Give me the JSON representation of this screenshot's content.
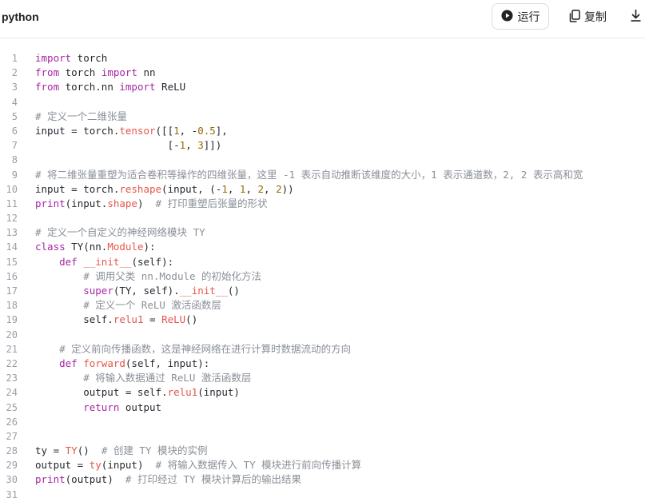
{
  "header": {
    "language": "python",
    "run_label": "运行",
    "copy_label": "复制",
    "run_icon": "play-circle-icon",
    "copy_icon": "copy-icon",
    "download_icon": "download-icon"
  },
  "code": {
    "lines": [
      {
        "n": "1",
        "t": [
          [
            "kw",
            "import"
          ],
          [
            "p",
            " torch"
          ]
        ]
      },
      {
        "n": "2",
        "t": [
          [
            "kw",
            "from"
          ],
          [
            "p",
            " torch "
          ],
          [
            "kw",
            "import"
          ],
          [
            "p",
            " nn"
          ]
        ]
      },
      {
        "n": "3",
        "t": [
          [
            "kw",
            "from"
          ],
          [
            "p",
            " torch.nn "
          ],
          [
            "kw",
            "import"
          ],
          [
            "p",
            " ReLU"
          ]
        ]
      },
      {
        "n": "4",
        "t": []
      },
      {
        "n": "5",
        "t": [
          [
            "cm",
            "# 定义一个二维张量"
          ]
        ]
      },
      {
        "n": "6",
        "t": [
          [
            "p",
            "input = torch."
          ],
          [
            "fn",
            "tensor"
          ],
          [
            "p",
            "([["
          ],
          [
            "num",
            "1"
          ],
          [
            "p",
            ", -"
          ],
          [
            "num",
            "0.5"
          ],
          [
            "p",
            "],"
          ]
        ]
      },
      {
        "n": "7",
        "t": [
          [
            "p",
            "                      ["
          ],
          [
            "p",
            "-"
          ],
          [
            "num",
            "1"
          ],
          [
            "p",
            ", "
          ],
          [
            "num",
            "3"
          ],
          [
            "p",
            "]])"
          ]
        ]
      },
      {
        "n": "8",
        "t": []
      },
      {
        "n": "9",
        "t": [
          [
            "cm",
            "# 将二维张量重塑为适合卷积等操作的四维张量，这里 -1 表示自动推断该维度的大小，1 表示通道数，2, 2 表示高和宽"
          ]
        ]
      },
      {
        "n": "10",
        "t": [
          [
            "p",
            "input = torch."
          ],
          [
            "fn",
            "reshape"
          ],
          [
            "p",
            "(input, (-"
          ],
          [
            "num",
            "1"
          ],
          [
            "p",
            ", "
          ],
          [
            "num",
            "1"
          ],
          [
            "p",
            ", "
          ],
          [
            "num",
            "2"
          ],
          [
            "p",
            ", "
          ],
          [
            "num",
            "2"
          ],
          [
            "p",
            "))"
          ]
        ]
      },
      {
        "n": "11",
        "t": [
          [
            "kw",
            "print"
          ],
          [
            "p",
            "(input."
          ],
          [
            "fn",
            "shape"
          ],
          [
            "p",
            ")  "
          ],
          [
            "cm",
            "# 打印重塑后张量的形状"
          ]
        ]
      },
      {
        "n": "12",
        "t": []
      },
      {
        "n": "13",
        "t": [
          [
            "cm",
            "# 定义一个自定义的神经网络模块 TY"
          ]
        ]
      },
      {
        "n": "14",
        "t": [
          [
            "kw",
            "class"
          ],
          [
            "p",
            " TY(nn."
          ],
          [
            "fn",
            "Module"
          ],
          [
            "p",
            "):"
          ]
        ]
      },
      {
        "n": "15",
        "t": [
          [
            "p",
            "    "
          ],
          [
            "kw",
            "def"
          ],
          [
            "p",
            " "
          ],
          [
            "fn",
            "__init__"
          ],
          [
            "p",
            "(self):"
          ]
        ]
      },
      {
        "n": "16",
        "t": [
          [
            "p",
            "        "
          ],
          [
            "cm",
            "# 调用父类 nn.Module 的初始化方法"
          ]
        ]
      },
      {
        "n": "17",
        "t": [
          [
            "p",
            "        "
          ],
          [
            "kw",
            "super"
          ],
          [
            "p",
            "(TY, self)."
          ],
          [
            "fn",
            "__init__"
          ],
          [
            "p",
            "()"
          ]
        ]
      },
      {
        "n": "18",
        "t": [
          [
            "p",
            "        "
          ],
          [
            "cm",
            "# 定义一个 ReLU 激活函数层"
          ]
        ]
      },
      {
        "n": "19",
        "t": [
          [
            "p",
            "        self."
          ],
          [
            "fn",
            "relu1"
          ],
          [
            "p",
            " = "
          ],
          [
            "fn",
            "ReLU"
          ],
          [
            "p",
            "()"
          ]
        ]
      },
      {
        "n": "20",
        "t": []
      },
      {
        "n": "21",
        "t": [
          [
            "p",
            "    "
          ],
          [
            "cm",
            "# 定义前向传播函数，这是神经网络在进行计算时数据流动的方向"
          ]
        ]
      },
      {
        "n": "22",
        "t": [
          [
            "p",
            "    "
          ],
          [
            "kw",
            "def"
          ],
          [
            "p",
            " "
          ],
          [
            "fn",
            "forward"
          ],
          [
            "p",
            "(self, input):"
          ]
        ]
      },
      {
        "n": "23",
        "t": [
          [
            "p",
            "        "
          ],
          [
            "cm",
            "# 将输入数据通过 ReLU 激活函数层"
          ]
        ]
      },
      {
        "n": "24",
        "t": [
          [
            "p",
            "        output = self."
          ],
          [
            "fn",
            "relu1"
          ],
          [
            "p",
            "(input)"
          ]
        ]
      },
      {
        "n": "25",
        "t": [
          [
            "p",
            "        "
          ],
          [
            "kw",
            "return"
          ],
          [
            "p",
            " output"
          ]
        ]
      },
      {
        "n": "26",
        "t": []
      },
      {
        "n": "27",
        "t": []
      },
      {
        "n": "28",
        "t": [
          [
            "p",
            "ty = "
          ],
          [
            "fn",
            "TY"
          ],
          [
            "p",
            "()  "
          ],
          [
            "cm",
            "# 创建 TY 模块的实例"
          ]
        ]
      },
      {
        "n": "29",
        "t": [
          [
            "p",
            "output = "
          ],
          [
            "fn",
            "ty"
          ],
          [
            "p",
            "(input)  "
          ],
          [
            "cm",
            "# 将输入数据传入 TY 模块进行前向传播计算"
          ]
        ]
      },
      {
        "n": "30",
        "t": [
          [
            "kw",
            "print"
          ],
          [
            "p",
            "(output)  "
          ],
          [
            "cm",
            "# 打印经过 TY 模块计算后的输出结果"
          ]
        ]
      },
      {
        "n": "31",
        "t": []
      }
    ]
  }
}
